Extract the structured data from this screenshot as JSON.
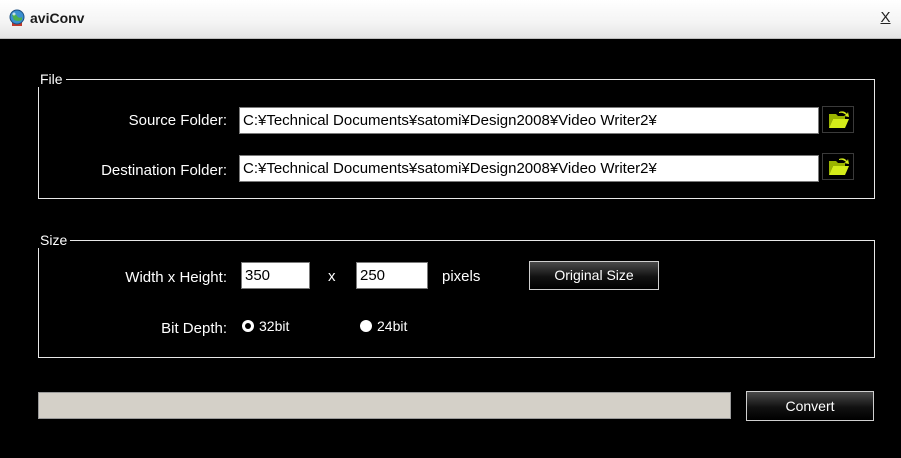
{
  "window": {
    "title": "aviConv",
    "app_icon": "globe-app-icon",
    "close_label": "X"
  },
  "file_group": {
    "legend": "File",
    "source": {
      "label": "Source Folder:",
      "value": "C:¥Technical Documents¥satomi¥Design2008¥Video Writer2¥",
      "browse_icon": "open-folder-icon"
    },
    "destination": {
      "label": "Destination Folder:",
      "value": "C:¥Technical Documents¥satomi¥Design2008¥Video Writer2¥",
      "browse_icon": "open-folder-icon"
    }
  },
  "size_group": {
    "legend": "Size",
    "dimensions_label": "Width x Height:",
    "width": "350",
    "separator": "x",
    "height": "250",
    "unit": "pixels",
    "original_size_label": "Original Size",
    "bit_depth_label": "Bit Depth:",
    "bit_depth_options": [
      {
        "label": "32bit",
        "selected": true
      },
      {
        "label": "24bit",
        "selected": false
      }
    ]
  },
  "progress": {
    "value": 0
  },
  "convert_label": "Convert",
  "colors": {
    "background": "#000000",
    "folder_icon": "#c8e000",
    "progress_track": "#d4d0c8"
  }
}
